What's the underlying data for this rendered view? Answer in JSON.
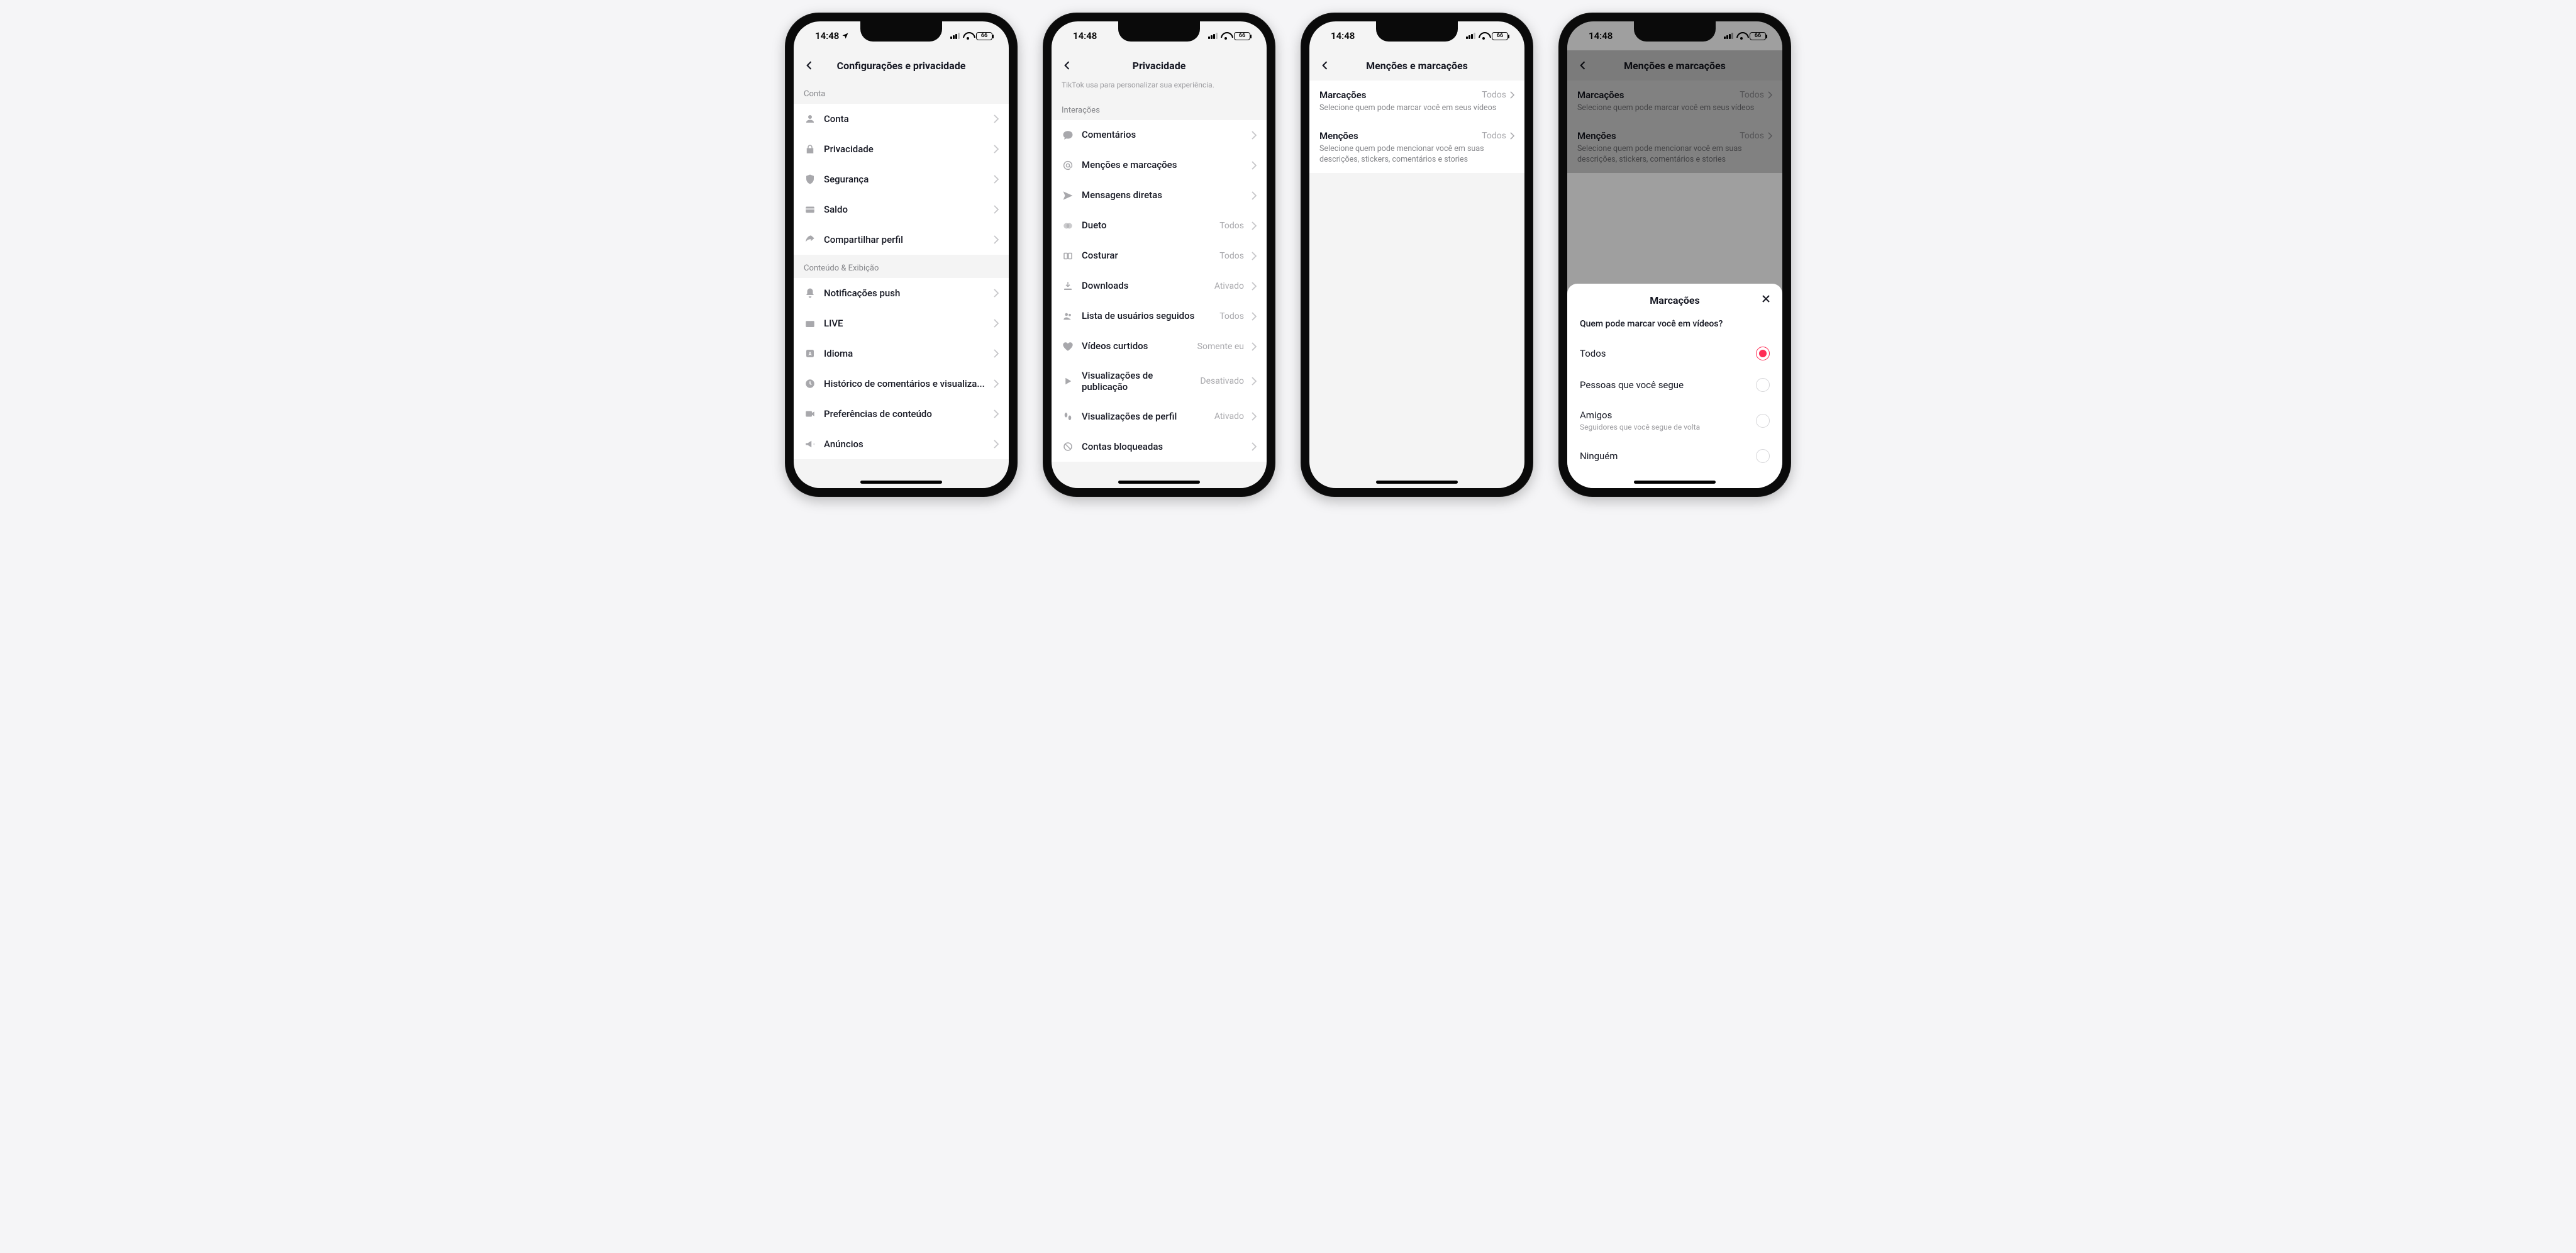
{
  "status": {
    "time": "14:48",
    "battery": "66"
  },
  "screens": {
    "settings": {
      "title": "Configurações e privacidade",
      "section_account": "Conta",
      "section_content": "Conteúdo & Exibição",
      "items1": {
        "account": "Conta",
        "privacy": "Privacidade",
        "security": "Segurança",
        "balance": "Saldo",
        "share_profile": "Compartilhar perfil"
      },
      "items2": {
        "push": "Notificações push",
        "live": "LIVE",
        "language": "Idioma",
        "history": "Histórico de comentários e visualiza...",
        "content_prefs": "Preferências de conteúdo",
        "ads": "Anúncios"
      }
    },
    "privacy": {
      "title": "Privacidade",
      "blurb": "TikTok usa para personalizar sua experiência.",
      "section": "Interações",
      "items": {
        "comments": {
          "label": "Comentários",
          "value": ""
        },
        "mentions": {
          "label": "Menções e marcações",
          "value": ""
        },
        "dm": {
          "label": "Mensagens diretas",
          "value": ""
        },
        "duet": {
          "label": "Dueto",
          "value": "Todos"
        },
        "stitch": {
          "label": "Costurar",
          "value": "Todos"
        },
        "downloads": {
          "label": "Downloads",
          "value": "Ativado"
        },
        "following_list": {
          "label": "Lista de usuários seguidos",
          "value": "Todos"
        },
        "liked_videos": {
          "label": "Vídeos curtidos",
          "value": "Somente eu"
        },
        "post_views": {
          "label": "Visualizações de publicação",
          "value": "Desativado"
        },
        "profile_views": {
          "label": "Visualizações de perfil",
          "value": "Ativado"
        },
        "blocked": {
          "label": "Contas bloqueadas",
          "value": ""
        }
      }
    },
    "mentions": {
      "title": "Menções e marcações",
      "tags": {
        "title": "Marcações",
        "value": "Todos",
        "desc": "Selecione quem pode marcar você em seus vídeos"
      },
      "mentions": {
        "title": "Menções",
        "value": "Todos",
        "desc": "Selecione quem pode mencionar você em suas descrições, stickers, comentários e stories"
      }
    },
    "sheet": {
      "title": "Marcações",
      "question": "Quem pode marcar você em vídeos?",
      "options": {
        "everyone": "Todos",
        "following": "Pessoas que você segue",
        "friends": "Amigos",
        "friends_sub": "Seguidores que você segue de volta",
        "noone": "Ninguém"
      }
    }
  }
}
